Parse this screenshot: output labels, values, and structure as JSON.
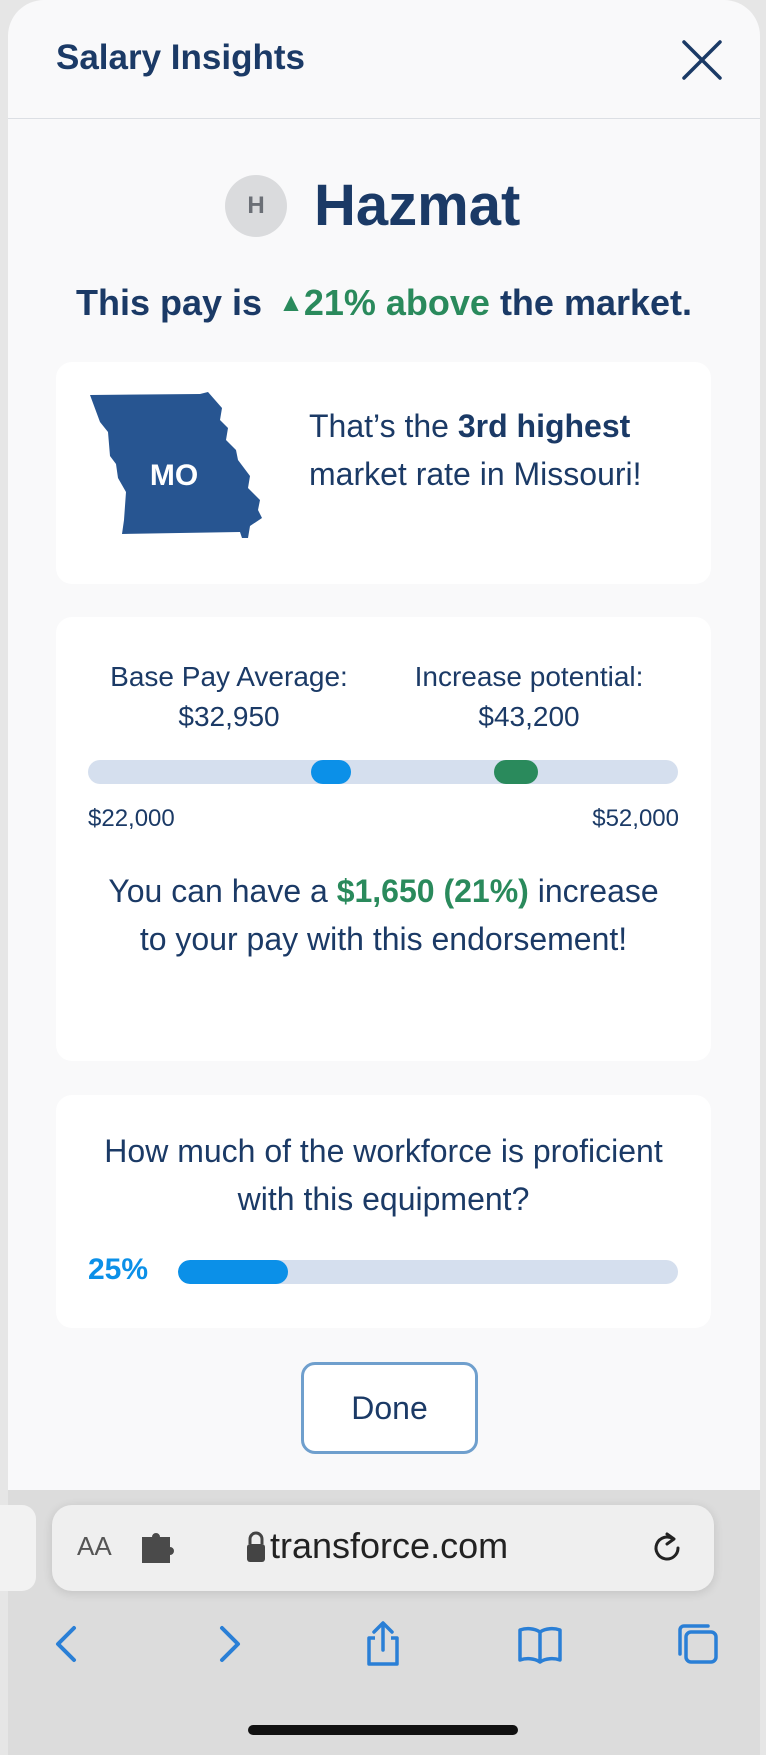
{
  "header": {
    "title": "Salary Insights"
  },
  "item": {
    "avatar_initial": "H",
    "name": "Hazmat"
  },
  "pay_comparison": {
    "prefix": "This pay is",
    "arrow": "▲",
    "percent_text": "21% above",
    "suffix": "the market."
  },
  "ranking": {
    "state_abbr": "MO",
    "text_pre": "That’s the ",
    "rank": "3rd highest",
    "text_post": " market rate in Missouri!"
  },
  "pay_range": {
    "base_label": "Base Pay Average:",
    "base_value": "$32,950",
    "potential_label": "Increase potential:",
    "potential_value": "$43,200",
    "min_label": "$22,000",
    "max_label": "$52,000",
    "increase_pre": "You can have a ",
    "increase_amount": "$1,650 (21%)",
    "increase_post": " increase to your pay with this endorsement!"
  },
  "workforce": {
    "question": "How much of the workforce is proficient with this equipment?",
    "percent_label": "25%",
    "fill_fraction": 0.22
  },
  "actions": {
    "done_label": "Done"
  },
  "browser": {
    "aa_label": "AA",
    "url": "transforce.com"
  },
  "colors": {
    "navy": "#1b3a66",
    "green": "#2a8a5c",
    "blue": "#0b90e8",
    "state_fill": "#275591",
    "track": "#d5dfee"
  }
}
